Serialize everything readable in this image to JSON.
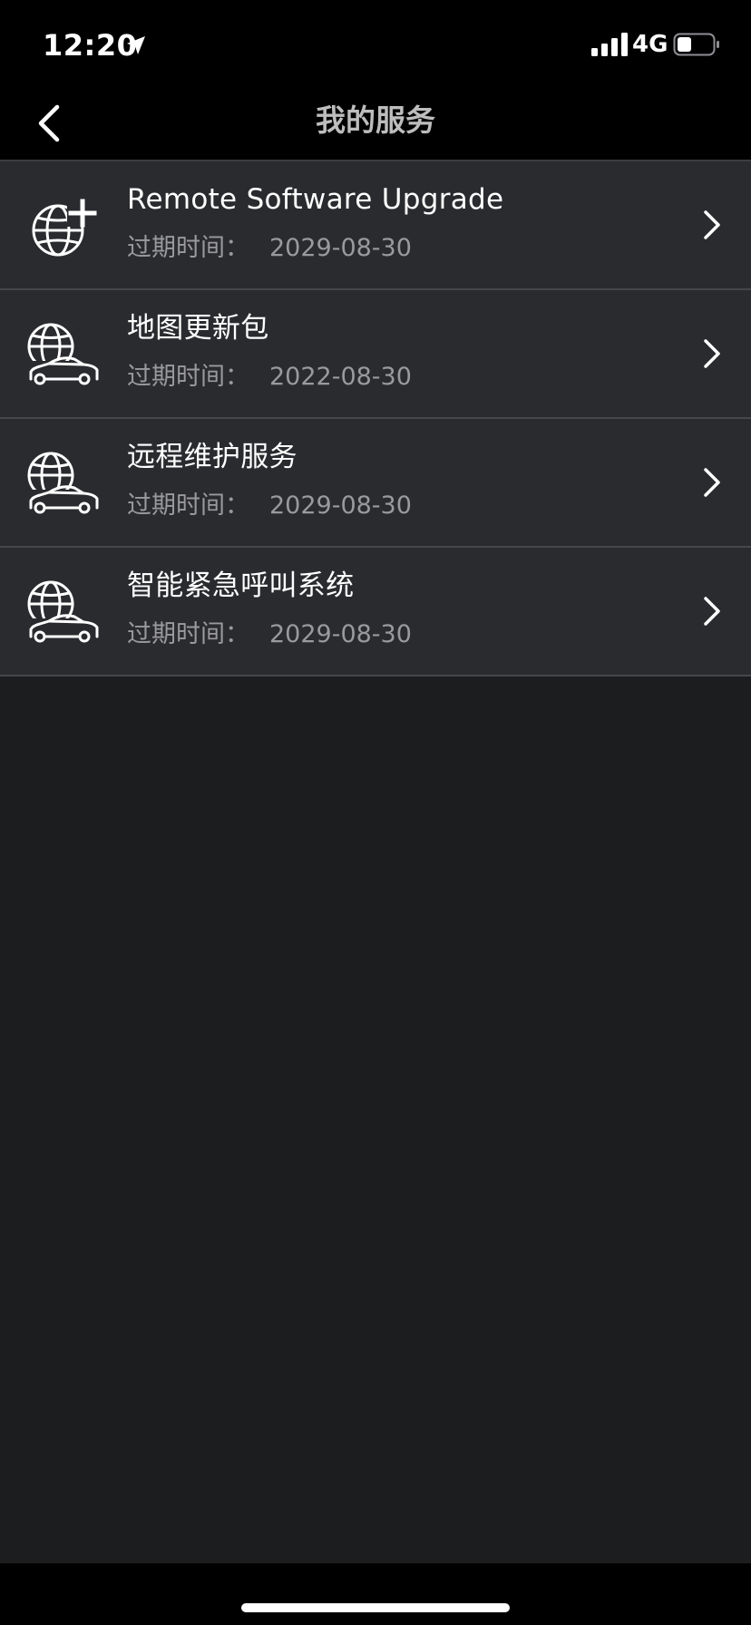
{
  "status_bar": {
    "time": "12:20",
    "network": "4G",
    "icons": [
      "location-arrow-icon",
      "signal-icon",
      "battery-icon"
    ]
  },
  "nav": {
    "title": "我的服务",
    "back_icon": "chevron-left-icon"
  },
  "services": [
    {
      "title": "Remote Software Upgrade",
      "expiry_label": "过期时间：",
      "expiry_date": "2029-08-30",
      "icon": "globe-plus-icon"
    },
    {
      "title": "地图更新包",
      "expiry_label": "过期时间：",
      "expiry_date": "2022-08-30",
      "icon": "globe-car-icon"
    },
    {
      "title": "远程维护服务",
      "expiry_label": "过期时间：",
      "expiry_date": "2029-08-30",
      "icon": "globe-car-icon"
    },
    {
      "title": "智能紧急呼叫系统",
      "expiry_label": "过期时间：",
      "expiry_date": "2029-08-30",
      "icon": "globe-car-icon"
    }
  ],
  "colors": {
    "background": "#1c1d1f",
    "row_background": "#2a2b2f",
    "bar_background": "#000000",
    "secondary_text": "#9a9a9e"
  }
}
